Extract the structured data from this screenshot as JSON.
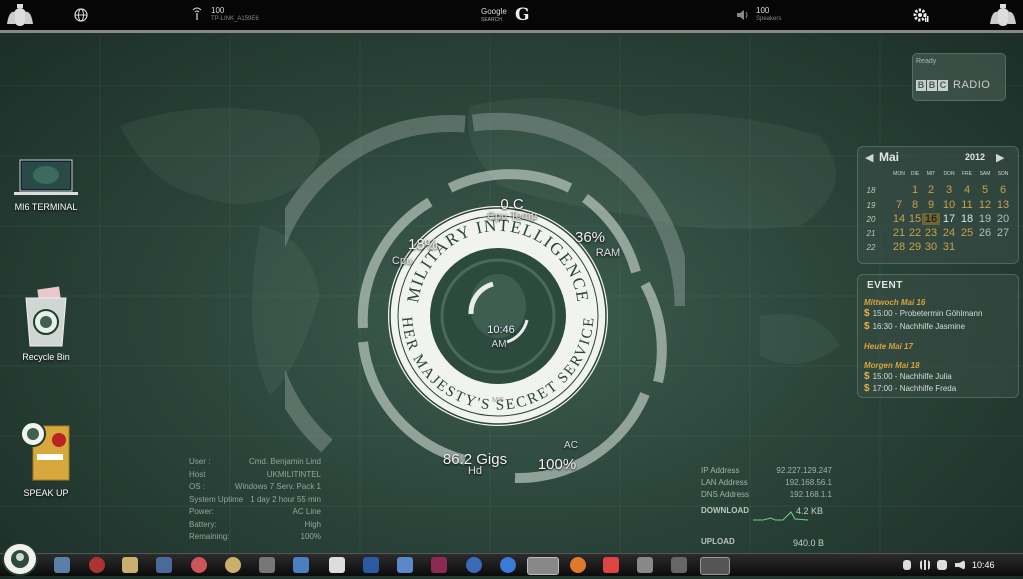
{
  "topbar": {
    "wifi": {
      "value": "100",
      "sub": "TP-LINK_A159E6"
    },
    "search": {
      "label": "Google",
      "sub": "SEARCH",
      "g": "G"
    },
    "sound": {
      "value": "100",
      "sub": "Speakers"
    }
  },
  "desktop": {
    "icons": [
      {
        "label": "MI6 TERMINAL"
      },
      {
        "label": "Recycle Bin"
      },
      {
        "label": "SPEAK UP"
      }
    ]
  },
  "radio": {
    "status": "Ready",
    "logo_letters": [
      "B",
      "B",
      "C"
    ],
    "radio_label": "RADIO"
  },
  "calendar": {
    "month": "Mai",
    "year": "2012",
    "dow": [
      "MON",
      "DIE",
      "MIT",
      "DON",
      "FRE",
      "SAM",
      "SON"
    ],
    "weeks": [
      "18",
      "19",
      "20",
      "21",
      "22"
    ],
    "rows": [
      [
        "",
        "1",
        "2",
        "3",
        "4",
        "5",
        "6"
      ],
      [
        "7",
        "8",
        "9",
        "10",
        "11",
        "12",
        "13"
      ],
      [
        "14",
        "15",
        "16",
        "17",
        "18",
        "19",
        "20"
      ],
      [
        "21",
        "22",
        "23",
        "24",
        "25",
        "26",
        "27"
      ],
      [
        "28",
        "29",
        "30",
        "31",
        "",
        "",
        ""
      ]
    ],
    "today": "16"
  },
  "events": {
    "header": "EVENT",
    "groups": [
      {
        "day": "Mittwoch Mai 16",
        "items": [
          "15:00 - Probetermin Göhlmann",
          "16:30 - Nachhilfe Jasmine"
        ]
      },
      {
        "day": "Heute Mai 17",
        "items": []
      },
      {
        "day": "Morgen Mai 18",
        "items": [
          "15:00 - Nachhilfe Julia",
          "17:00 - Nachhilfe Freda"
        ]
      }
    ]
  },
  "gauge": {
    "cpu_temp_value": "0 C",
    "cpu_temp_label": "Cpu Temp",
    "cpu_value": "18%",
    "cpu_label": "Cpu",
    "ram_value": "36%",
    "ram_label": "RAM",
    "hd_value": "86.2 Gigs",
    "hd_label": "Hd",
    "battery_value": "100%",
    "battery_label": "AC",
    "seal_top": "MILITARY INTELLIGENCE",
    "seal_bottom": "HER MAJESTY'S SECRET SERVICE",
    "seal_small": "MI6",
    "time": "10:46",
    "ampm": "AM"
  },
  "sysinfo": [
    {
      "k": "User :",
      "v": "Cmd. Benjamin Lind"
    },
    {
      "k": "Host",
      "v": "UKMILITINTEL"
    },
    {
      "k": "OS :",
      "v": "Windows 7 Serv. Pack 1"
    },
    {
      "k": "System Uptime",
      "v": "1 day 2 hour 55 min"
    },
    {
      "k": "Power:",
      "v": "AC Line"
    },
    {
      "k": "Battery:",
      "v": "High"
    },
    {
      "k": "Remaining:",
      "v": "100%"
    }
  ],
  "network": {
    "rows": [
      {
        "k": "IP Address",
        "v": "92.227.129.247"
      },
      {
        "k": "LAN Address",
        "v": "192.168.56.1"
      },
      {
        "k": "DNS Address",
        "v": "192.168.1.1"
      }
    ],
    "download_label": "DOWNLOAD",
    "download_value": "4.2 KB",
    "upload_label": "UPLOAD",
    "upload_value": "940.0 B"
  },
  "taskbar": {
    "clock": "10:46"
  },
  "colors": {
    "accent": "#d8a33a",
    "today": "#b98a2a",
    "bg": "#2b453b"
  }
}
